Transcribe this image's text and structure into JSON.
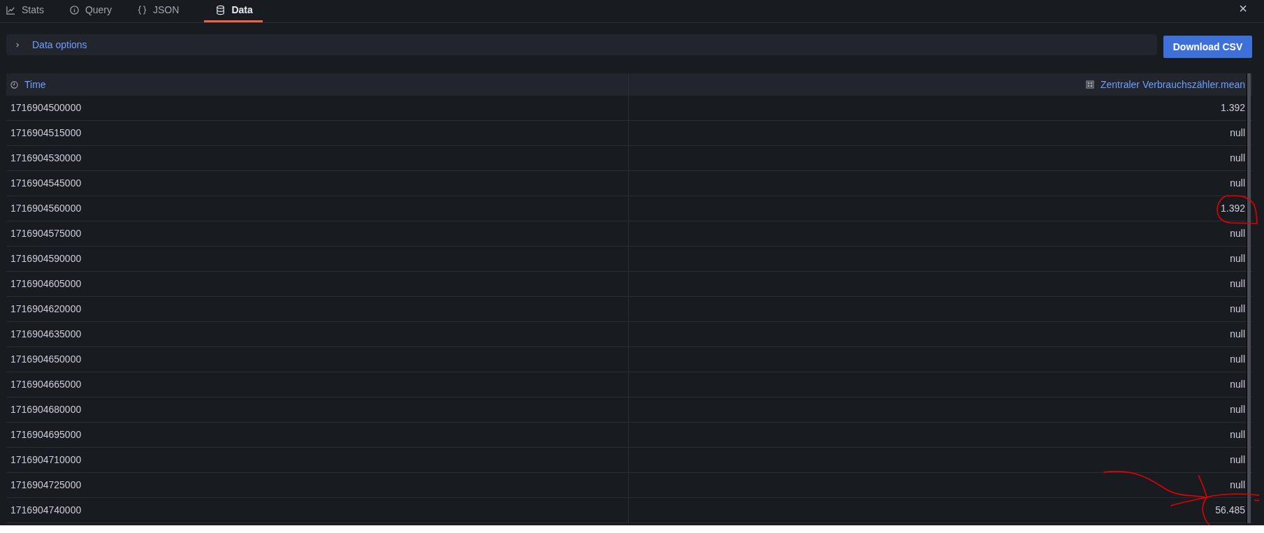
{
  "tabs": [
    {
      "label": "Stats",
      "selected": false
    },
    {
      "label": "Query",
      "selected": false
    },
    {
      "label": "JSON",
      "selected": false
    },
    {
      "label": "Data",
      "selected": true
    }
  ],
  "close": "×",
  "data_options": {
    "label": "Data options",
    "expanded": false
  },
  "download_button": "Download CSV",
  "table": {
    "columns": [
      "Time",
      "Zentraler Verbrauchszähler.mean"
    ],
    "rows": [
      {
        "time": "1716904500000",
        "value": "1.392",
        "circled": false
      },
      {
        "time": "1716904515000",
        "value": "null",
        "circled": false
      },
      {
        "time": "1716904530000",
        "value": "null",
        "circled": false
      },
      {
        "time": "1716904545000",
        "value": "null",
        "circled": false
      },
      {
        "time": "1716904560000",
        "value": "1.392",
        "circled": true
      },
      {
        "time": "1716904575000",
        "value": "null",
        "circled": false
      },
      {
        "time": "1716904590000",
        "value": "null",
        "circled": false
      },
      {
        "time": "1716904605000",
        "value": "null",
        "circled": false
      },
      {
        "time": "1716904620000",
        "value": "null",
        "circled": false
      },
      {
        "time": "1716904635000",
        "value": "null",
        "circled": false
      },
      {
        "time": "1716904650000",
        "value": "null",
        "circled": false
      },
      {
        "time": "1716904665000",
        "value": "null",
        "circled": false
      },
      {
        "time": "1716904680000",
        "value": "null",
        "circled": false
      },
      {
        "time": "1716904695000",
        "value": "null",
        "circled": false
      },
      {
        "time": "1716904710000",
        "value": "null",
        "circled": false
      },
      {
        "time": "1716904725000",
        "value": "null",
        "circled": false
      },
      {
        "time": "1716904740000",
        "value": "56.485",
        "circled": true
      }
    ]
  }
}
